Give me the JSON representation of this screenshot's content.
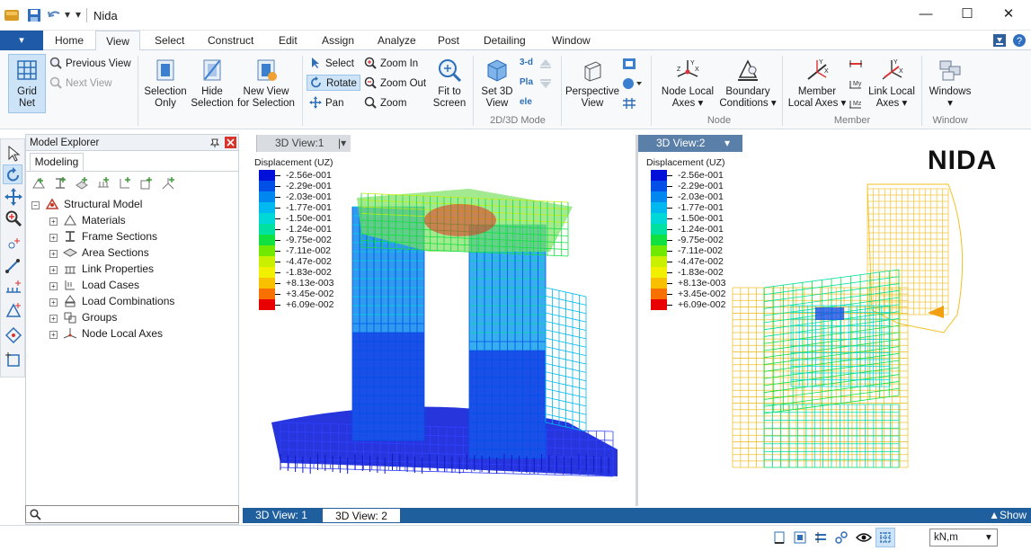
{
  "app": {
    "title": "Nida"
  },
  "window_controls": {
    "minimize": "—",
    "maximize": "☐",
    "close": "✕"
  },
  "tabs": [
    "Home",
    "View",
    "Select",
    "Construct",
    "Edit",
    "Assign",
    "Analyze",
    "Post",
    "Detailing",
    "Window"
  ],
  "active_tab": "View",
  "ribbon": {
    "grid_net": [
      "Grid",
      "Net"
    ],
    "previous_view": "Previous View",
    "next_view": "Next View",
    "selection_only": [
      "Selection",
      "Only"
    ],
    "hide_selection": [
      "Hide",
      "Selection"
    ],
    "new_view": [
      "New View",
      "for Selection"
    ],
    "select": "Select",
    "rotate": "Rotate",
    "pan": "Pan",
    "zoom_in": "Zoom In",
    "zoom_out": "Zoom Out",
    "zoom": "Zoom",
    "fit": [
      "Fit to",
      "Screen"
    ],
    "set3d": [
      "Set 3D",
      "View"
    ],
    "mode_icons": [
      "3-d",
      "Pla",
      "ele"
    ],
    "group_2d3d": "2D/3D Mode",
    "perspective": [
      "Perspective",
      "View"
    ],
    "node_local": [
      "Node Local",
      "Axes"
    ],
    "boundary": [
      "Boundary",
      "Conditions"
    ],
    "group_node": "Node",
    "member_local": [
      "Member",
      "Local Axes"
    ],
    "link_local": [
      "Link Local",
      "Axes"
    ],
    "group_member": "Member",
    "windows": "Windows",
    "group_window": "Window"
  },
  "explorer": {
    "title": "Model Explorer",
    "tab": "Modeling",
    "root": "Structural Model",
    "items": [
      "Materials",
      "Frame Sections",
      "Area Sections",
      "Link Properties",
      "Load Cases",
      "Load Combinations",
      "Groups",
      "Node Local Axes"
    ]
  },
  "viewports": [
    {
      "tab": "3D View:1",
      "legend_title": "Displacement (UZ)"
    },
    {
      "tab": "3D View:2",
      "legend_title": "Displacement (UZ)"
    }
  ],
  "legend": {
    "values": [
      "-2.56e-001",
      "-2.29e-001",
      "-2.03e-001",
      "-1.77e-001",
      "-1.50e-001",
      "-1.24e-001",
      "-9.75e-002",
      "-7.11e-002",
      "-4.47e-002",
      "-1.83e-002",
      "+8.13e-003",
      "+3.45e-002",
      "+6.09e-002"
    ],
    "colors": [
      "#0010d8",
      "#0050e8",
      "#0088f0",
      "#00b8f0",
      "#00d8d8",
      "#00e0a0",
      "#10e040",
      "#70e800",
      "#c8f000",
      "#f0f000",
      "#f8c000",
      "#f87000",
      "#e80000"
    ]
  },
  "logo": "NIDA",
  "bottom_tabs": [
    "3D View: 1",
    "3D View: 2"
  ],
  "active_bottom_tab": "3D View: 2",
  "show_label": "Show",
  "units": "kN,m"
}
